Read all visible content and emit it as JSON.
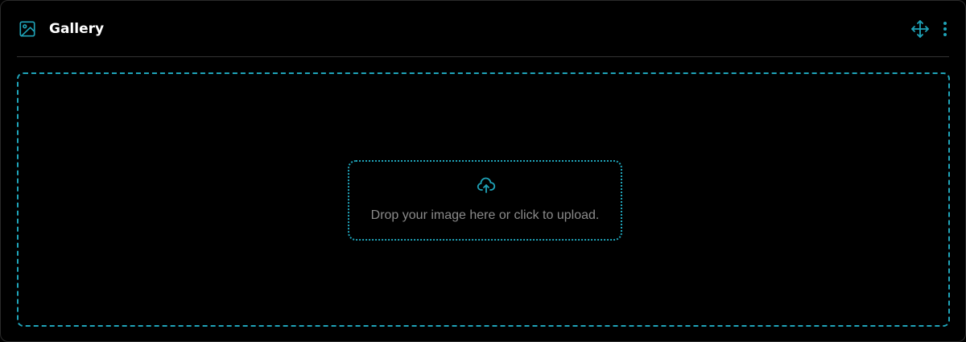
{
  "panel": {
    "title": "Gallery",
    "icons": {
      "title_icon": "image-icon",
      "move": "move-arrows-icon",
      "menu": "more-vertical-icon",
      "upload": "cloud-upload-icon"
    }
  },
  "dropzone": {
    "prompt": "Drop your image here or click to upload."
  },
  "colors": {
    "accent": "#1fa3b8",
    "background": "#000000",
    "title_text": "#ffffff",
    "muted_text": "#8a8a8a"
  }
}
